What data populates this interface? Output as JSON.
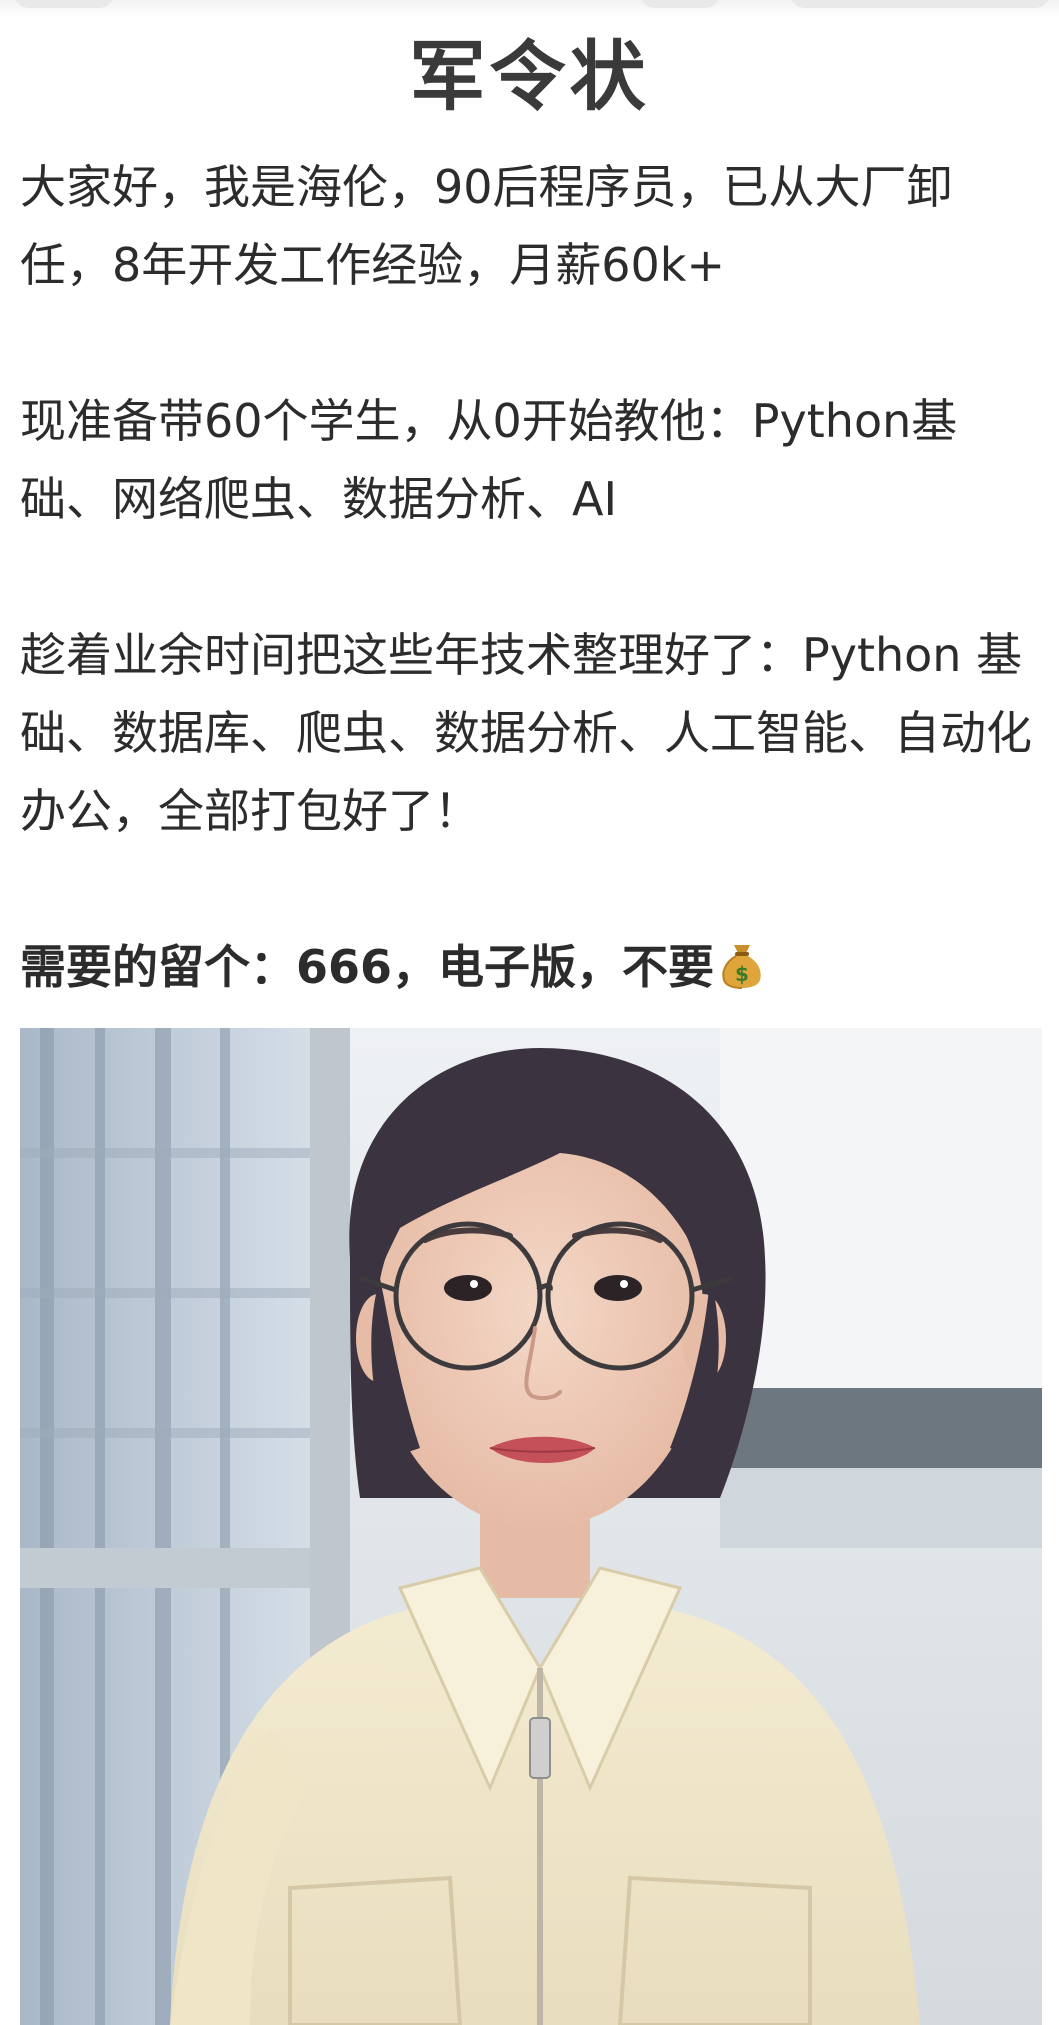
{
  "post": {
    "title": "军令状",
    "paragraphs": [
      "大家好，我是海伦，90后程序员，已从大厂卸任，8年开发工作经验，月薪60k+",
      "现准备带60个学生，从0开始教他：Python基础、网络爬虫、数据分析、AI",
      "趁着业余时间把这些年技术整理好了：Python 基础、数据库、爬虫、数据分析、人工智能、自动化办公，全部打包好了！"
    ],
    "cta_text": "需要的留个：666，电子版，不要",
    "cta_icon": "money-bag-icon"
  },
  "colors": {
    "text": "#2c2c2c",
    "title": "#3a3a3a",
    "background": "#ffffff"
  }
}
